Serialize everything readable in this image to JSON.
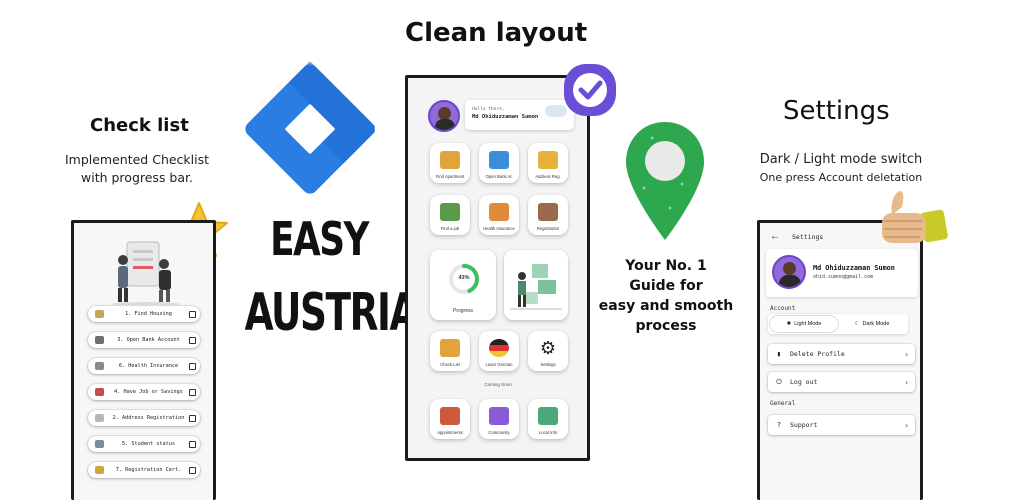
{
  "left": {
    "title": "Check list",
    "desc1": "Implemented Checklist",
    "desc2": "with progress bar.",
    "items": [
      {
        "label": "1. Find Housing",
        "color": "#c9a45c"
      },
      {
        "label": "3. Open Bank Account",
        "color": "#6d6d6d"
      },
      {
        "label": "6. Health Insurance",
        "color": "#8b8b8b"
      },
      {
        "label": "4. Have Job or Savings",
        "color": "#c0504d"
      },
      {
        "label": "2. Address Registration",
        "color": "#b7b7b7"
      },
      {
        "label": "5. Student status",
        "color": "#7a8aa0"
      },
      {
        "label": "7. Registration Cert.",
        "color": "#d1a540"
      }
    ]
  },
  "brand": {
    "line1": "EASY",
    "line2": "AUSTRIA",
    "logo_color": "#2a7de1"
  },
  "center": {
    "title": "Clean layout",
    "greeting": "Hello there,",
    "username": "Md Ohiduzzaman Sumon",
    "tiles_row1": [
      "Find Apartment",
      "Open Bank Ac",
      "Address Reg."
    ],
    "tiles_row2": [
      "Find a job",
      "Health Insurance",
      "Registration"
    ],
    "progress_value": "43%",
    "progress_fraction": 0.43,
    "progress_label": "Progress",
    "tiles_row3": [
      "Check List",
      "Learn German",
      "Settings"
    ],
    "coming_soon": "Coming Soon",
    "tiles_row4": [
      "Appointments",
      "Community",
      "Local Info"
    ],
    "accent": "#3cbf5c"
  },
  "middle_right": {
    "line1": "Your No. 1",
    "line2": "Guide for",
    "line3": "easy and smooth",
    "line4": "process"
  },
  "right": {
    "title": "Settings",
    "desc1": "Dark / Light mode switch",
    "desc2": "One press Account deletation",
    "header": "Settings",
    "back_icon": "arrow-left-icon",
    "name": "Md Ohiduzzaman Sumon",
    "email": "ohid.sumon@gmail.com",
    "section_account": "Account",
    "light_mode": "Light Mode",
    "dark_mode": "Dark Mode",
    "delete_profile": "Delete Profile",
    "log_out": "Log out",
    "section_general": "General",
    "support": "Support"
  }
}
